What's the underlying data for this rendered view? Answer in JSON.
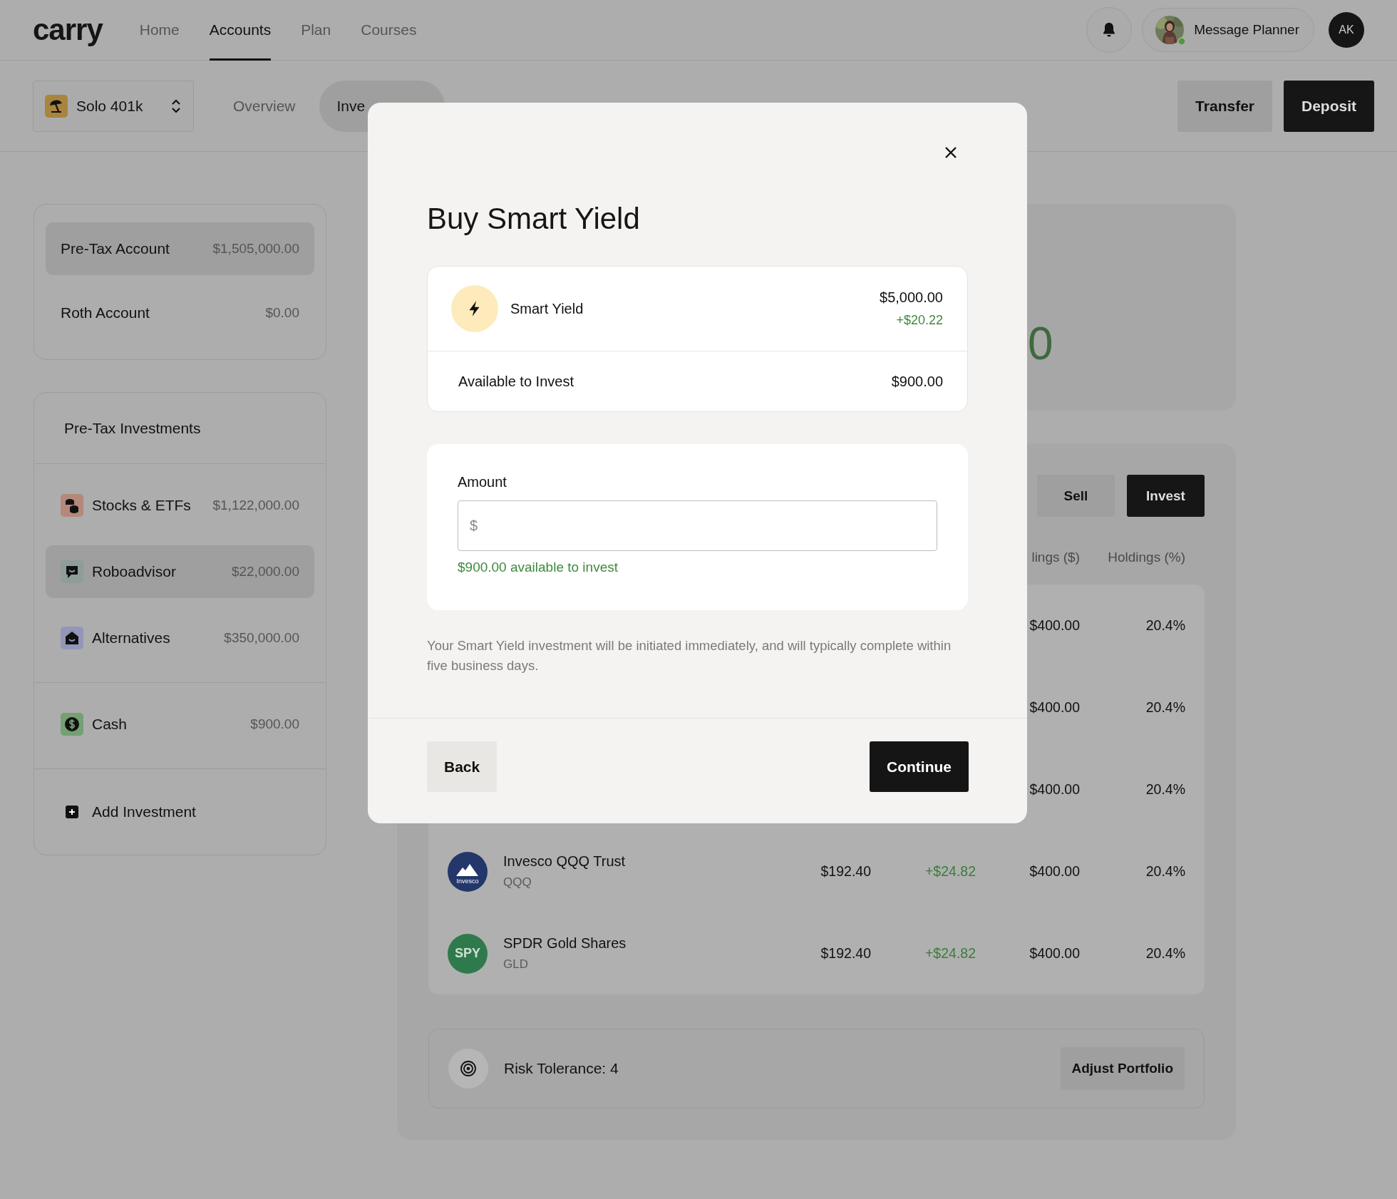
{
  "nav": {
    "logo": "carry",
    "links": [
      {
        "label": "Home",
        "selected": false
      },
      {
        "label": "Accounts",
        "selected": true
      },
      {
        "label": "Plan",
        "selected": false
      },
      {
        "label": "Courses",
        "selected": false
      }
    ],
    "message_button": "Message Planner",
    "avatar": "AK"
  },
  "subnav": {
    "account_selector": "Solo 401k",
    "tabs": [
      {
        "label": "Overview",
        "selected": false
      },
      {
        "label": "Inve",
        "selected": true
      }
    ],
    "actions": [
      {
        "label": "Transfer",
        "kind": "secondary"
      },
      {
        "label": "Deposit",
        "kind": "primary"
      }
    ]
  },
  "accounts": [
    {
      "name": "Pre-Tax Account",
      "value": "$1,505,000.00",
      "selected": true
    },
    {
      "name": "Roth Account",
      "value": "$0.00",
      "selected": false
    }
  ],
  "investments": {
    "title": "Pre-Tax Investments",
    "groups": [
      [
        {
          "name": "Stocks & ETFs",
          "value": "$1,122,000.00",
          "kind": "coins",
          "color": "#b4897a",
          "selected": false
        },
        {
          "name": "Roboadvisor",
          "value": "$22,000.00",
          "kind": "chat",
          "color": "#8e9c9a",
          "selected": true
        },
        {
          "name": "Alternatives",
          "value": "$350,000.00",
          "kind": "house",
          "color": "#9396b8",
          "selected": false
        }
      ],
      [
        {
          "name": "Cash",
          "value": "$900.00",
          "kind": "dollar",
          "color": "#74a072",
          "selected": false
        }
      ]
    ],
    "add_label": "Add Investment"
  },
  "balance_card": {
    "value": "0"
  },
  "holdings": {
    "actions": [
      {
        "label": "Sell",
        "kind": "secondary"
      },
      {
        "label": "Invest",
        "kind": "primary"
      }
    ],
    "columns": [
      {
        "label": "lings ($)"
      },
      {
        "label": "Holdings (%)"
      }
    ],
    "rows": [
      {
        "holdings_value": "$400.00",
        "holdings_pct": "20.4%"
      },
      {
        "holdings_value": "$400.00",
        "holdings_pct": "20.4%"
      },
      {
        "holdings_value": "$400.00",
        "holdings_pct": "20.4%"
      },
      {
        "name": "Invesco QQQ Trust",
        "ticker": "QQQ",
        "kind": "mountain",
        "logo_text": "Invesco",
        "price": "$192.40",
        "change": "+$24.82",
        "holdings_value": "$400.00",
        "holdings_pct": "20.4%"
      },
      {
        "name": "SPDR Gold Shares",
        "ticker": "GLD",
        "kind": "text",
        "logo_text": "SPY",
        "price": "$192.40",
        "change": "+$24.82",
        "holdings_value": "$400.00",
        "holdings_pct": "20.4%"
      }
    ]
  },
  "risk": {
    "label": "Risk Tolerance: 4",
    "button": "Adjust Portfolio"
  },
  "modal": {
    "title": "Buy Smart Yield",
    "product": {
      "name": "Smart Yield",
      "value": "$5,000.00",
      "change": "+$20.22"
    },
    "available": {
      "label": "Available to Invest",
      "value": "$900.00"
    },
    "amount": {
      "label": "Amount",
      "placeholder": "$",
      "hint": "$900.00 available to invest"
    },
    "note": "Your Smart Yield investment will be initiated immediately, and will typically complete within five business days.",
    "buttons": [
      {
        "label": "Back",
        "kind": "secondary"
      },
      {
        "label": "Continue",
        "kind": "primary"
      }
    ]
  }
}
